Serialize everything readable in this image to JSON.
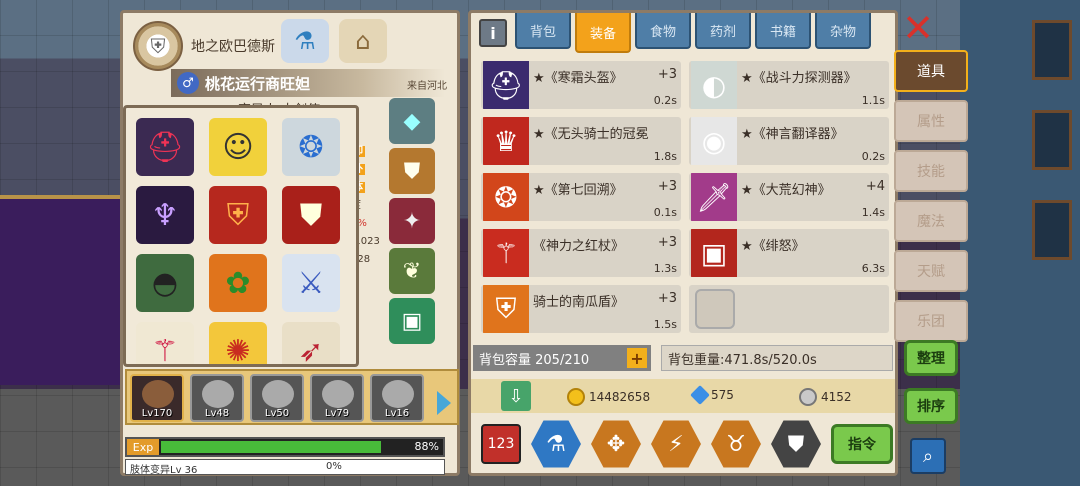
{
  "character": {
    "title": "地之欧巴德斯",
    "name": "桃花运行商旺妲",
    "from": "来自河北",
    "subtitle": "变异人 大剑使",
    "stat_tags": [
      "卸",
      "外",
      "体"
    ],
    "stat_lines": [
      "度",
      "0%",
      "/1023",
      "728"
    ]
  },
  "party": [
    {
      "level": "Lv170",
      "active": true
    },
    {
      "level": "Lv48"
    },
    {
      "level": "Lv50"
    },
    {
      "level": "Lv79"
    },
    {
      "level": "Lv16"
    }
  ],
  "exp": {
    "label": "Exp",
    "percent": "88%",
    "fraction": 0.88
  },
  "mutation": {
    "label": "肢体变异Lv 36",
    "percent": "0%"
  },
  "bag": {
    "tabs": [
      "背包",
      "装备",
      "食物",
      "药剂",
      "书籍",
      "杂物"
    ],
    "active_tab": 1,
    "items": [
      {
        "name": "★《寒霜头盔》",
        "level": "+3",
        "weight": "0.2s",
        "icon": "helmet-icon",
        "color": "#3b2b6e"
      },
      {
        "name": "★《战斗力探测器》",
        "level": "",
        "weight": "1.1s",
        "icon": "scouter-icon",
        "color": "#cfd8d3"
      },
      {
        "name": "★《无头骑士的冠冕",
        "level": "",
        "weight": "1.8s",
        "icon": "crown-icon",
        "color": "#c0281e"
      },
      {
        "name": "★《神言翻译器》",
        "level": "",
        "weight": "0.2s",
        "icon": "headphone-icon",
        "color": "#e7e7e7"
      },
      {
        "name": "★《第七回溯》",
        "level": "+3",
        "weight": "0.1s",
        "icon": "necklace-icon",
        "color": "#d2461b"
      },
      {
        "name": "★《大荒幻神》",
        "level": "+4",
        "weight": "1.4s",
        "icon": "dagger-icon",
        "color": "#a23b8a"
      },
      {
        "name": "《神力之红杖》",
        "level": "+3",
        "weight": "1.3s",
        "icon": "staff-icon",
        "color": "#c92c1f"
      },
      {
        "name": "★《绯怒》",
        "level": "",
        "weight": "6.3s",
        "icon": "chest-icon",
        "color": "#b3261d"
      },
      {
        "name": "骑士的南瓜盾》",
        "level": "+3",
        "weight": "1.5s",
        "icon": "pumpkin-shield-icon",
        "color": "#e0741c"
      },
      {
        "name": "",
        "level": "",
        "weight": "",
        "icon": "empty-slot",
        "color": "#cfc8bb"
      }
    ],
    "capacity": "背包容量 205/210",
    "capacity_plus": "+",
    "weight": "背包重量:471.8s/520.0s",
    "currency": {
      "gold": "14482658",
      "diamond": "575",
      "silver": "4152"
    },
    "command_label": "指令"
  },
  "side_menu": {
    "tabs": [
      "道具",
      "属性",
      "技能",
      "魔法",
      "天赋",
      "乐团"
    ],
    "active": 0,
    "sort_label": "整理",
    "order_label": "排序"
  }
}
